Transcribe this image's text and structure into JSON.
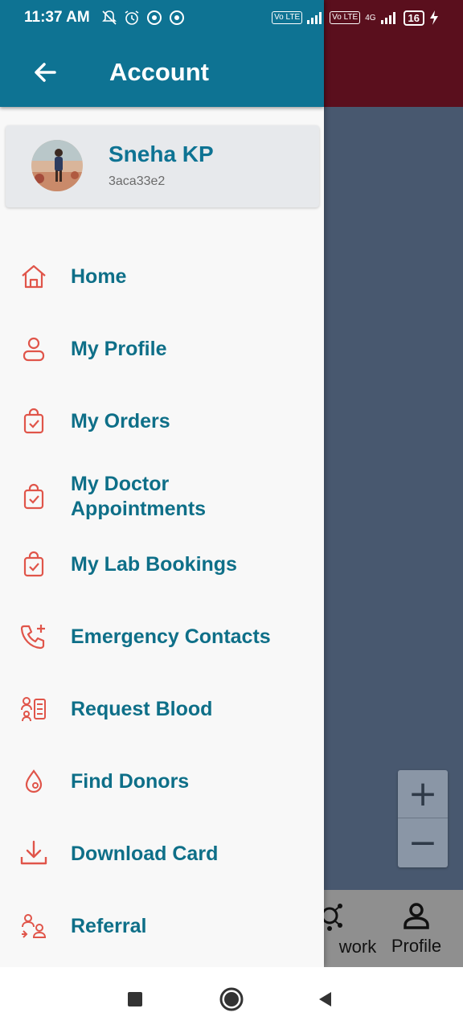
{
  "status_bar": {
    "time": "11:37 AM",
    "signal_chip_1": "Vo LTE",
    "signal_chip_2": "Vo LTE",
    "network_type": "4G",
    "battery": "16"
  },
  "drawer": {
    "title": "Account",
    "profile": {
      "name": "Sneha KP",
      "id": "3aca33e2"
    },
    "menu_items": [
      {
        "label": "Home",
        "icon": "home-icon"
      },
      {
        "label": "My Profile",
        "icon": "person-icon"
      },
      {
        "label": "My Orders",
        "icon": "shopping-bag-check-icon"
      },
      {
        "label": "My Doctor Appointments",
        "icon": "shopping-bag-check-icon"
      },
      {
        "label": "My Lab Bookings",
        "icon": "shopping-bag-check-icon"
      },
      {
        "label": "Emergency Contacts",
        "icon": "phone-plus-icon"
      },
      {
        "label": "Request Blood",
        "icon": "request-blood-icon"
      },
      {
        "label": "Find Donors",
        "icon": "blood-drop-icon"
      },
      {
        "label": "Download Card",
        "icon": "download-icon"
      },
      {
        "label": "Referral",
        "icon": "referral-icon"
      }
    ]
  },
  "background": {
    "zoom_in": "+",
    "zoom_out": "−",
    "nav_partial_label": "work",
    "nav_profile_label": "Profile"
  },
  "colors": {
    "primary": "#0e7393",
    "icon_accent": "#e0554a",
    "drawer_bg": "#f8f8f8",
    "overlay_bg": "#48586f"
  }
}
